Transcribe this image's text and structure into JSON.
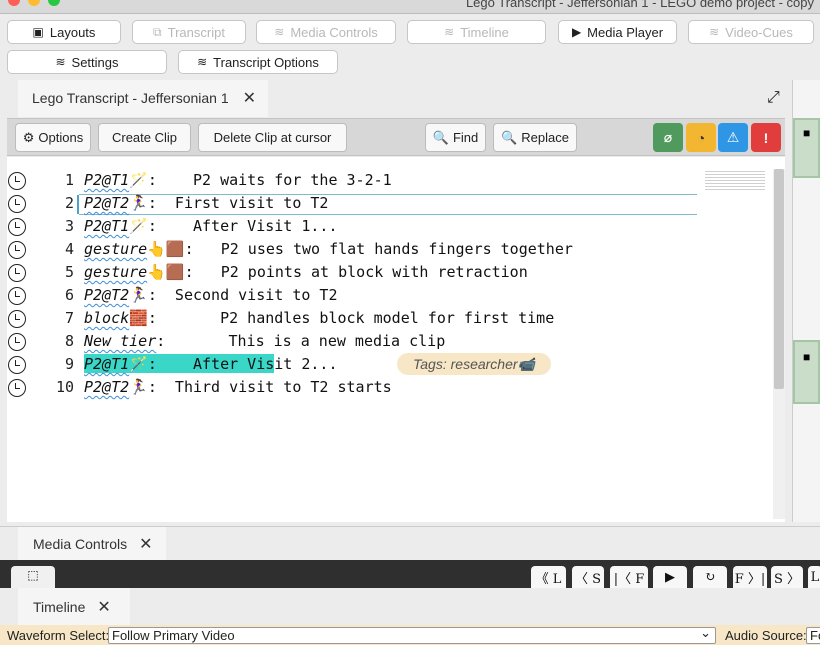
{
  "window": {
    "title": "Lego Transcript - Jeffersonian 1 - LEGO demo project - copy"
  },
  "top_buttons": {
    "layouts": "Layouts",
    "transcript": "Transcript",
    "media_controls": "Media Controls",
    "timeline": "Timeline",
    "media_player": "Media Player",
    "video_cues": "Video-Cues",
    "settings": "Settings",
    "transcript_options": "Transcript Options"
  },
  "panel": {
    "tab_title": "Lego Transcript - Jeffersonian 1",
    "close": "✕"
  },
  "toolbar": {
    "options": "Options",
    "create_clip": "Create Clip",
    "delete_clip": "Delete Clip at cursor",
    "find": "Find",
    "replace": "Replace"
  },
  "transcript_lines": [
    {
      "num": "1",
      "speaker": "P2@T1",
      "emoji": "🪄",
      "text": ":    P2 waits for the 3-2-1"
    },
    {
      "num": "2",
      "speaker": "P2@T2",
      "emoji": "🏃‍♀",
      "text": ":  First visit to T2"
    },
    {
      "num": "3",
      "speaker": "P2@T1",
      "emoji": "🪄",
      "text": ":    After Visit 1..."
    },
    {
      "num": "4",
      "speaker": "gesture",
      "emoji": "👆🟫",
      "text": ":   P2 uses two flat hands fingers together"
    },
    {
      "num": "5",
      "speaker": "gesture",
      "emoji": "👆🟫",
      "text": ":   P2 points at block with retraction"
    },
    {
      "num": "6",
      "speaker": "P2@T2",
      "emoji": "🏃‍♀",
      "text": ":  Second visit to T2"
    },
    {
      "num": "7",
      "speaker": "block",
      "emoji": "🧱",
      "text": ":       P2 handles block model for first time"
    },
    {
      "num": "8",
      "speaker": "New tier",
      "emoji": "",
      "text": ":       This is a new media clip"
    },
    {
      "num": "9",
      "speaker": "P2@T1",
      "emoji": "🪄",
      "text": ":    After Visit 2..."
    },
    {
      "num": "10",
      "speaker": "P2@T2",
      "emoji": "🏃‍♀",
      "text": ":  Third visit to T2 starts"
    }
  ],
  "tag": {
    "text": "Tags: researcher📹"
  },
  "media_controls": {
    "tab_title": "Media Controls",
    "close": "✕",
    "buttons": [
      "《 L",
      "〈 S",
      "|〈 F",
      "▶",
      "↻",
      "F 〉|",
      "S 〉",
      "L"
    ]
  },
  "timeline": {
    "tab_title": "Timeline",
    "close": "✕"
  },
  "waveform": {
    "label": "Waveform Select:",
    "value": "Follow Primary Video",
    "audio_label": "Audio Source:",
    "audio_value": "Fo"
  }
}
